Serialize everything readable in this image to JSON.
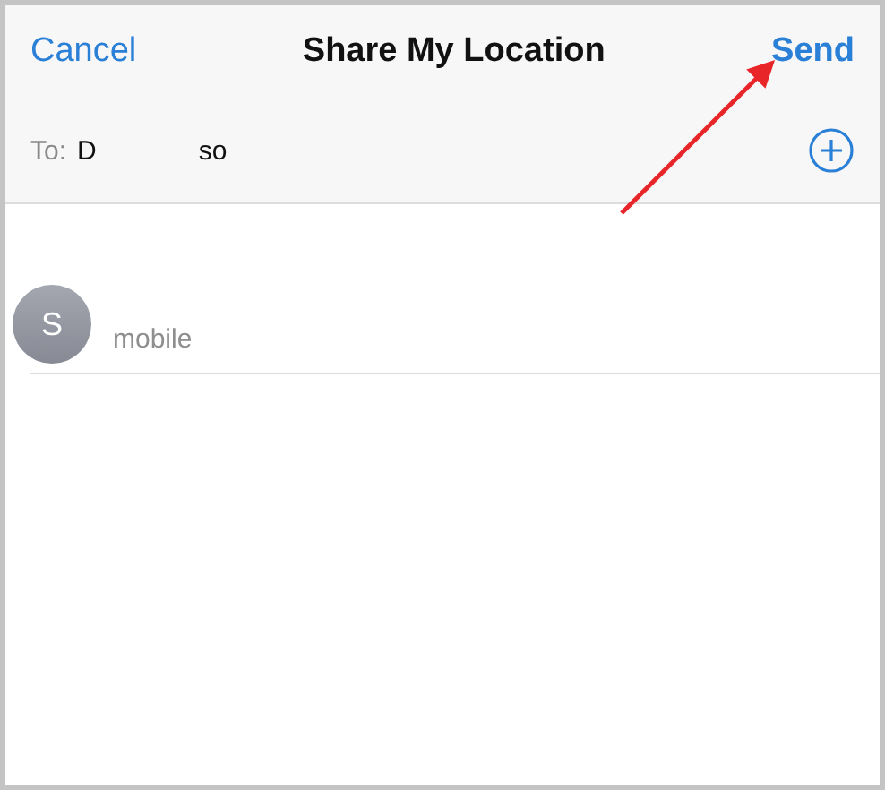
{
  "nav": {
    "cancel": "Cancel",
    "title": "Share My Location",
    "send": "Send"
  },
  "to": {
    "label": "To:",
    "recipients": [
      "D",
      "so"
    ]
  },
  "contacts": [
    {
      "initial": "S",
      "detail": "mobile"
    }
  ]
}
